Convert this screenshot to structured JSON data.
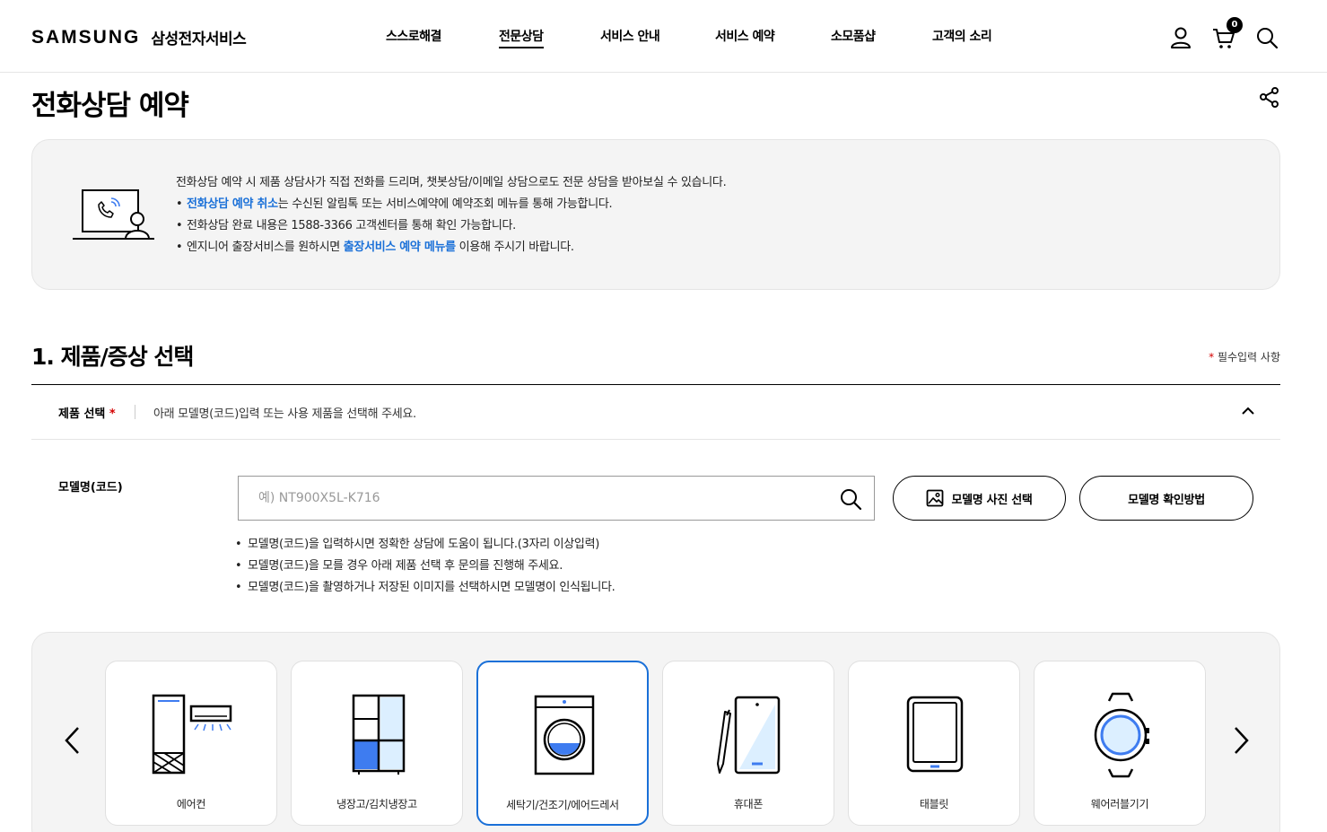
{
  "header": {
    "logo_word": "SAMSUNG",
    "logo_sub": "삼성전자서비스",
    "nav": [
      "스스로해결",
      "전문상담",
      "서비스 안내",
      "서비스 예약",
      "소모품샵",
      "고객의 소리"
    ],
    "active_nav": "전문상담",
    "cart_count": "0"
  },
  "page": {
    "title": "전화상담 예약"
  },
  "info": {
    "intro": "전화상담 예약 시 제품 상담사가 직접 전화를 드리며, 챗봇상담/이메일 상담으로도 전문 상담을 받아보실 수 있습니다.",
    "bullet1_link": "전화상담 예약 취소",
    "bullet1_rest": "는 수신된 알림톡 또는 서비스예약에 예약조회 메뉴를 통해 가능합니다.",
    "bullet2": "전화상담 완료 내용은 1588-3366 고객센터를 통해 확인 가능합니다.",
    "bullet3_pre": "엔지니어 출장서비스를 원하시면 ",
    "bullet3_link": "출장서비스 예약 메뉴를",
    "bullet3_post": " 이용해 주시기 바랍니다.",
    "bullet_char": "•"
  },
  "section1": {
    "title": "1. 제품/증상 선택",
    "required_star": "*",
    "required_note": " 필수입력 사항",
    "product_label": "제품 선택",
    "product_hint": "아래 모델명(코드)입력 또는 사용 제품을 선택해 주세요.",
    "model_label": "모델명(코드)",
    "search_placeholder": "예) NT900X5L-K716",
    "photo_button": "모델명 사진 선택",
    "how_button": "모델명 확인방법",
    "notes": [
      "모델명(코드)을 입력하시면 정확한 상담에 도움이 됩니다.(3자리 이상입력)",
      "모델명(코드)을 모를 경우 아래 제품 선택 후 문의를 진행해 주세요.",
      "모델명(코드)을 촬영하거나 저장된 이미지를 선택하시면 모델명이 인식됩니다."
    ]
  },
  "products": [
    {
      "label": "에어컨",
      "icon": "air-conditioner-icon"
    },
    {
      "label": "냉장고/김치냉장고",
      "icon": "refrigerator-icon"
    },
    {
      "label": "세탁기/건조기/에어드레서",
      "icon": "washer-icon"
    },
    {
      "label": "휴대폰",
      "icon": "phone-icon"
    },
    {
      "label": "태블릿",
      "icon": "tablet-icon"
    },
    {
      "label": "웨어러블기기",
      "icon": "watch-icon"
    }
  ],
  "selected_product": "세탁기/건조기/에어드레서",
  "colors": {
    "accent": "#1a70d8",
    "icon_blue": "#3e7cf0",
    "light_blue": "#dcefff",
    "required": "#d40000"
  }
}
